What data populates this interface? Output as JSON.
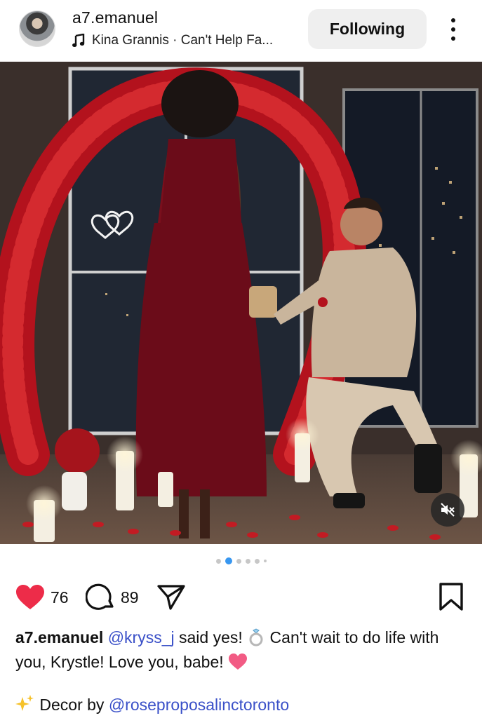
{
  "header": {
    "username": "a7.emanuel",
    "music": "Kina Grannis · Can't Help Fa...",
    "follow_label": "Following"
  },
  "icons": {
    "music": "music-note-icon",
    "more": "more-vertical-icon",
    "mute": "speaker-muted-icon",
    "like": "heart-filled-icon",
    "comment": "comment-icon",
    "share": "send-icon",
    "save": "bookmark-icon",
    "sparkles": "sparkles-icon",
    "ring": "ring-icon",
    "heart_emoji": "pink-heart-icon"
  },
  "colors": {
    "like": "#ed2c49",
    "mention": "#3a50c8",
    "carousel_active": "#3897f0"
  },
  "carousel": {
    "total": 6,
    "active_index": 1
  },
  "actions": {
    "likes": "76",
    "comments": "89"
  },
  "caption": {
    "username": "a7.emanuel",
    "mention": "@kryss_j",
    "text_before_ring": "said yes!",
    "text_after_ring": "Can't wait to do life with you, Krystle! Love you, babe!",
    "decor_prefix": "Decor by",
    "decor_mention": "@roseproposalinctoronto"
  }
}
